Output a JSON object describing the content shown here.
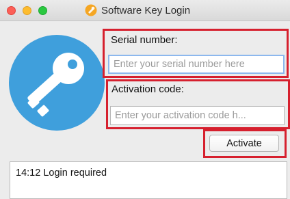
{
  "window": {
    "title": "Software Key Login",
    "app_icon": "key-login-app-icon",
    "logo_icon": "key-icon"
  },
  "form": {
    "serial_label": "Serial number:",
    "serial_value": "",
    "serial_placeholder": "Enter your serial number here",
    "activation_label": "Activation code:",
    "activation_value": "",
    "activation_placeholder": "Enter your activation code h...",
    "activate_label": "Activate"
  },
  "status": {
    "log": "14:12 Login required"
  },
  "colors": {
    "logo_blue": "#3f9fdc",
    "highlight_red": "#d6202e",
    "focus_ring": "#8db8ee"
  }
}
